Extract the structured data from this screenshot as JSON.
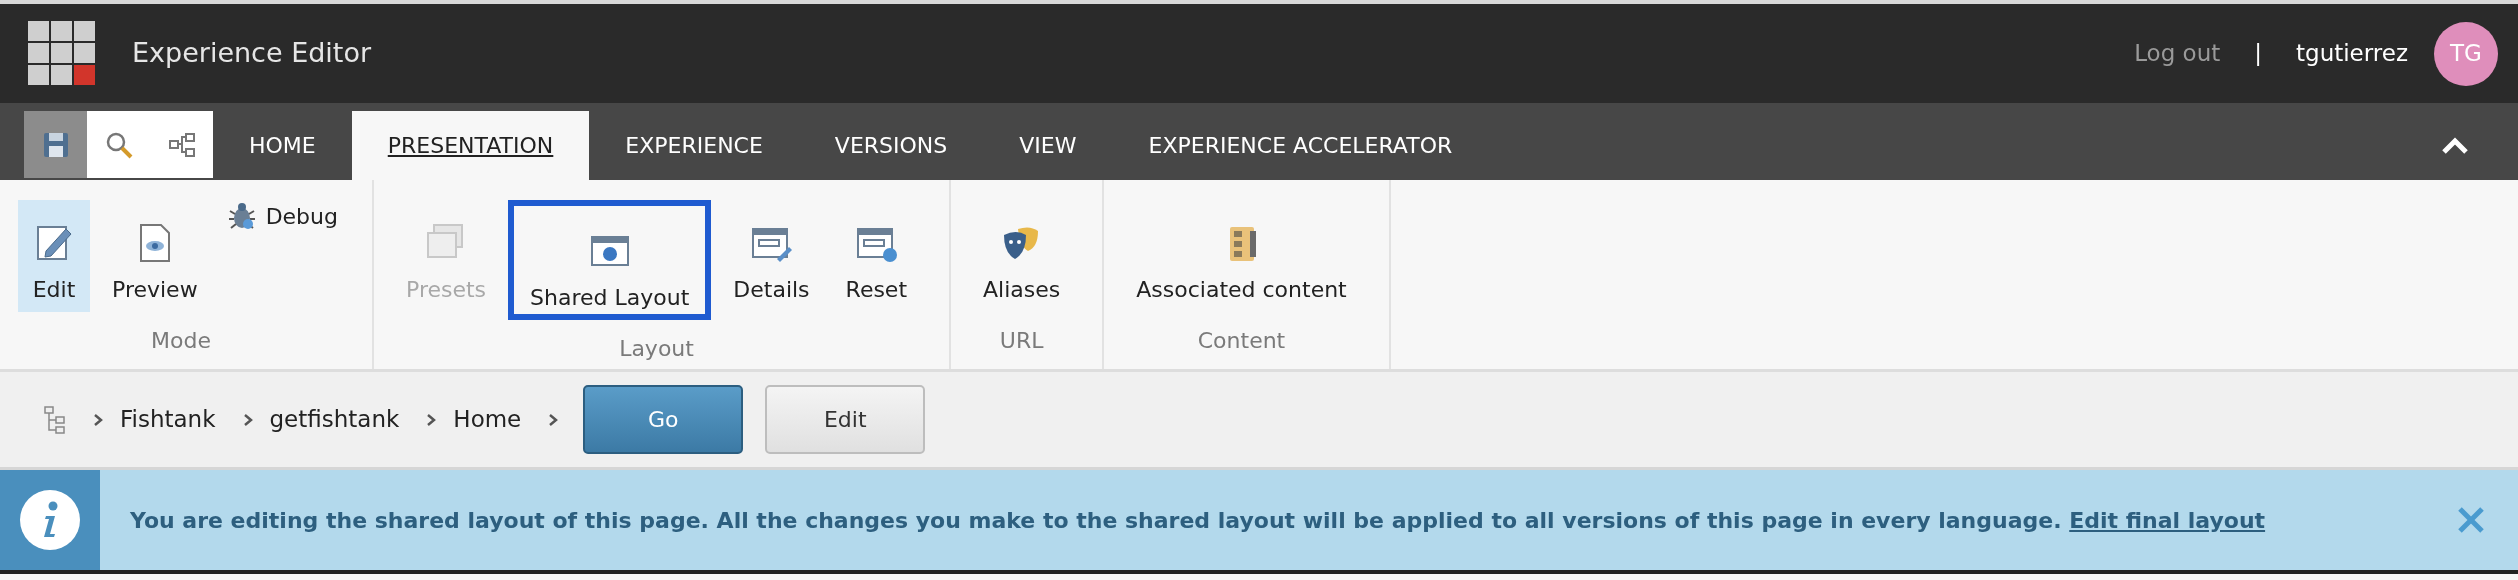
{
  "header": {
    "app_title": "Experience Editor",
    "logout": "Log out",
    "separator": "|",
    "username": "tgutierrez",
    "avatar_initials": "TG"
  },
  "quick_tools": [
    {
      "kind": "save",
      "selected": true
    },
    {
      "kind": "search",
      "selected": false
    },
    {
      "kind": "tree",
      "selected": false
    }
  ],
  "tabs": [
    {
      "label": "HOME",
      "selected": false
    },
    {
      "label": "PRESENTATION",
      "selected": true
    },
    {
      "label": "EXPERIENCE",
      "selected": false
    },
    {
      "label": "VERSIONS",
      "selected": false
    },
    {
      "label": "VIEW",
      "selected": false
    },
    {
      "label": "EXPERIENCE ACCELERATOR",
      "selected": false
    }
  ],
  "ribbon_groups": [
    {
      "label": "Mode",
      "commands": [
        {
          "label": "Edit",
          "kind": "edit",
          "small": false,
          "selected": true,
          "highlighted": false,
          "disabled": false
        },
        {
          "label": "Preview",
          "kind": "preview",
          "small": false,
          "selected": false,
          "highlighted": false,
          "disabled": false
        },
        {
          "label": "Debug",
          "kind": "debug",
          "small": true,
          "selected": false,
          "highlighted": false,
          "disabled": false
        }
      ]
    },
    {
      "label": "Layout",
      "commands": [
        {
          "label": "Presets",
          "kind": "presets",
          "small": false,
          "selected": false,
          "highlighted": false,
          "disabled": true
        },
        {
          "label": "Shared Layout",
          "kind": "shared",
          "small": false,
          "selected": false,
          "highlighted": true,
          "disabled": false
        },
        {
          "label": "Details",
          "kind": "details",
          "small": false,
          "selected": false,
          "highlighted": false,
          "disabled": false
        },
        {
          "label": "Reset",
          "kind": "reset",
          "small": false,
          "selected": false,
          "highlighted": false,
          "disabled": false
        }
      ]
    },
    {
      "label": "URL",
      "commands": [
        {
          "label": "Aliases",
          "kind": "aliases",
          "small": false,
          "selected": false,
          "highlighted": false,
          "disabled": false
        }
      ]
    },
    {
      "label": "Content",
      "commands": [
        {
          "label": "Associated content",
          "kind": "associated",
          "small": false,
          "selected": false,
          "highlighted": false,
          "disabled": false
        }
      ]
    }
  ],
  "breadcrumb": {
    "items": [
      "Fishtank",
      "getfishtank",
      "Home"
    ],
    "buttons": [
      {
        "label": "Go",
        "kind": "primary"
      },
      {
        "label": "Edit",
        "kind": "secondary"
      }
    ]
  },
  "notice": {
    "message": "You are editing the shared layout of this page. All the changes you make to the shared layout will be applied to all versions of this page in every language.",
    "link": "Edit final layout"
  }
}
